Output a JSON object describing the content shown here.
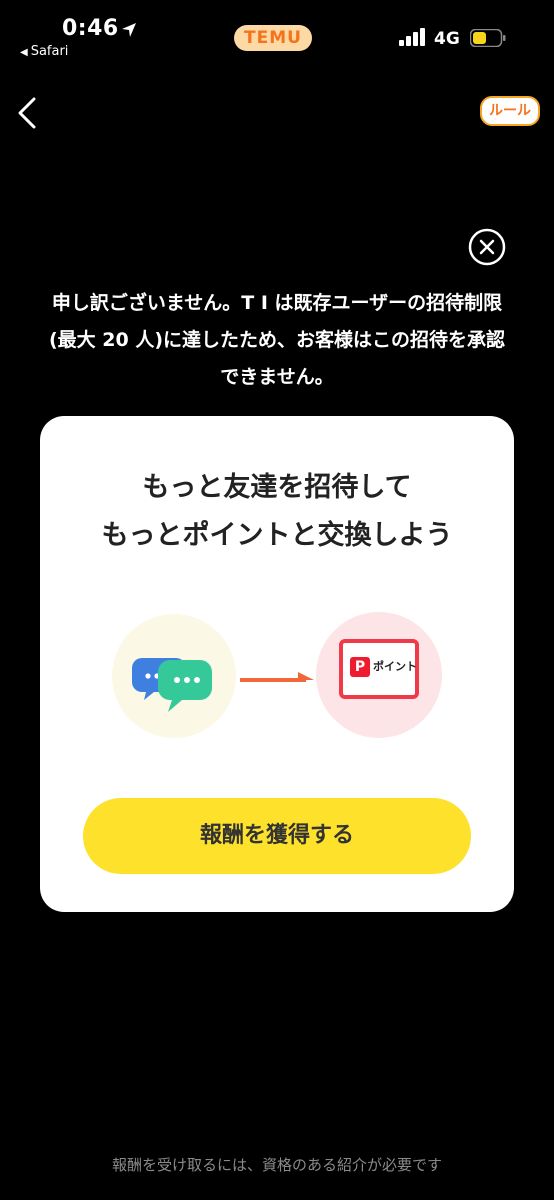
{
  "status_bar": {
    "time": "0:46",
    "back_app": "Safari",
    "network": "4G",
    "center_badge": "TEMU",
    "icons": [
      "location-arrow-icon",
      "signal-bars-icon",
      "battery-icon"
    ]
  },
  "nav": {
    "back_icon": "chevron-left-icon",
    "rules_label": "ルール"
  },
  "close_icon": "close-circle-icon",
  "message": {
    "line1": "申し訳ございません。T I は既存ユーザーの招待制限",
    "line2": "(最大 20 人)に達したため、お客様はこの招待を承認",
    "line3": "できません。"
  },
  "card": {
    "title_line1": "もっと友達を招待して",
    "title_line2": "もっとポイントと交換しよう",
    "chat_icon": "chat-bubbles-icon",
    "arrow_icon": "right-arrow-icon",
    "points_card_label": "ポイント",
    "points_logo": "P",
    "reward_button_label": "報酬を獲得する"
  },
  "footer_note": "報酬を受け取るには、資格のある紹介が必要です",
  "colors": {
    "background": "#000000",
    "accent_yellow": "#fde12b",
    "temu_orange": "#f5731b",
    "paypay_red": "#ee1c2e"
  }
}
